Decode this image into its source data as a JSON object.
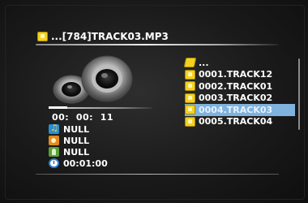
{
  "header": {
    "title": "...[784]TRACK03.MP3",
    "icon": "folder-icon"
  },
  "player": {
    "elapsed_time": "00:  00:  11",
    "progress": 0.18,
    "info": [
      {
        "icon": "note-icon",
        "value": "NULL"
      },
      {
        "icon": "album-icon",
        "value": "NULL"
      },
      {
        "icon": "person-icon",
        "value": "NULL"
      },
      {
        "icon": "clock-icon",
        "value": "00:01:00"
      }
    ]
  },
  "file_list": {
    "items": [
      {
        "icon": "open-folder-icon",
        "label": "...",
        "selected": false
      },
      {
        "icon": "folder-icon",
        "label": "0001.TRACK12",
        "selected": false
      },
      {
        "icon": "folder-icon",
        "label": "0002.TRACK01",
        "selected": false
      },
      {
        "icon": "folder-icon",
        "label": "0003.TRACK02",
        "selected": false
      },
      {
        "icon": "folder-icon",
        "label": "0004.TRACK03",
        "selected": true
      },
      {
        "icon": "folder-icon",
        "label": "0005.TRACK04",
        "selected": false
      }
    ]
  },
  "colors": {
    "selection": "#7fb2dd",
    "folder": "#f3d21f",
    "text": "#ffffff"
  }
}
